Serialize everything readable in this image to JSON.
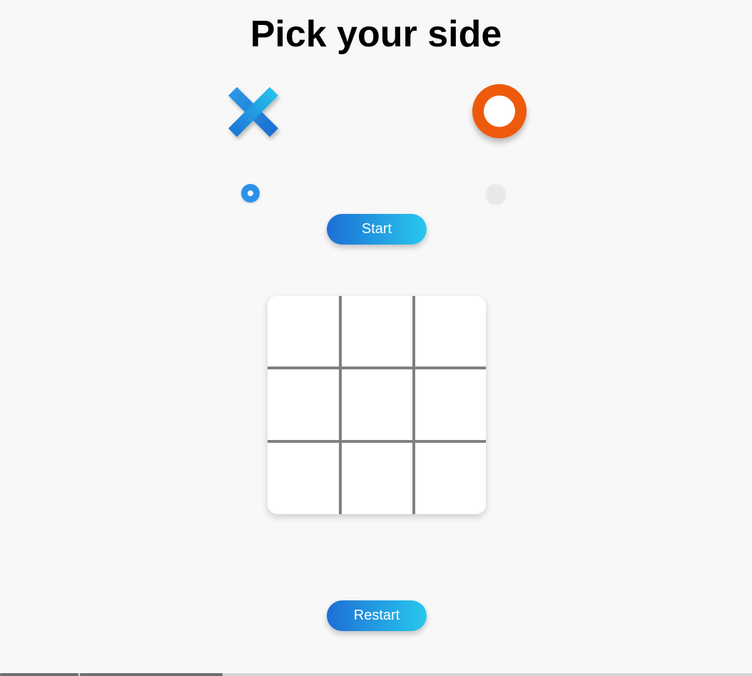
{
  "title": "Pick your side",
  "sides": {
    "x": {
      "icon": "x-mark-icon",
      "selected": true,
      "color_start": "#1d6fd4",
      "color_end": "#28c8ee"
    },
    "o": {
      "icon": "o-ring-icon",
      "selected": false,
      "color": "#ee5a0c"
    }
  },
  "buttons": {
    "start_label": "Start",
    "restart_label": "Restart",
    "gradient_start": "#1d6fd4",
    "gradient_end": "#28c8ee"
  },
  "board": {
    "rows": 3,
    "columns": 3,
    "cells": [
      "",
      "",
      "",
      "",
      "",
      "",
      "",
      "",
      ""
    ],
    "line_color": "#808080"
  }
}
